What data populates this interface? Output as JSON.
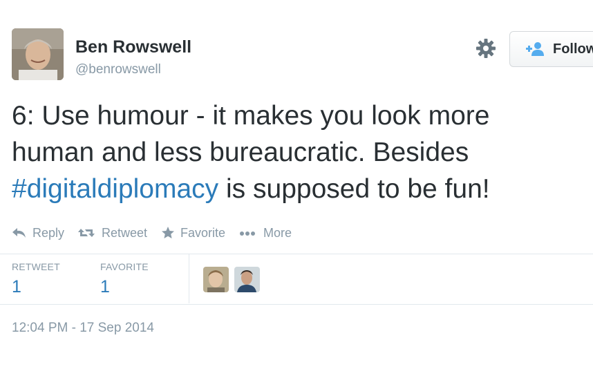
{
  "author": {
    "name": "Ben Rowswell",
    "handle": "@benrowswell"
  },
  "header": {
    "follow_label": "Follow",
    "settings_icon": "gear-icon",
    "follow_icon": "add-user-icon"
  },
  "tweet": {
    "text_line1": "6: Use humour - it makes you look more",
    "text_line2": "human and less bureaucratic. Besides",
    "hashtag": "#digitaldiplomacy",
    "text_line3_rest": " is supposed to be fun!"
  },
  "actions": {
    "reply": "Reply",
    "retweet": "Retweet",
    "favorite": "Favorite",
    "more": "More"
  },
  "stats": {
    "retweet_label": "RETWEET",
    "retweet_count": "1",
    "favorite_label": "FAVORITE",
    "favorite_count": "1"
  },
  "timestamp": "12:04 PM - 17 Sep 2014",
  "colors": {
    "link": "#2b7bb9",
    "text": "#292f33",
    "muted": "#8899a6",
    "divider": "#e1e8ed"
  }
}
